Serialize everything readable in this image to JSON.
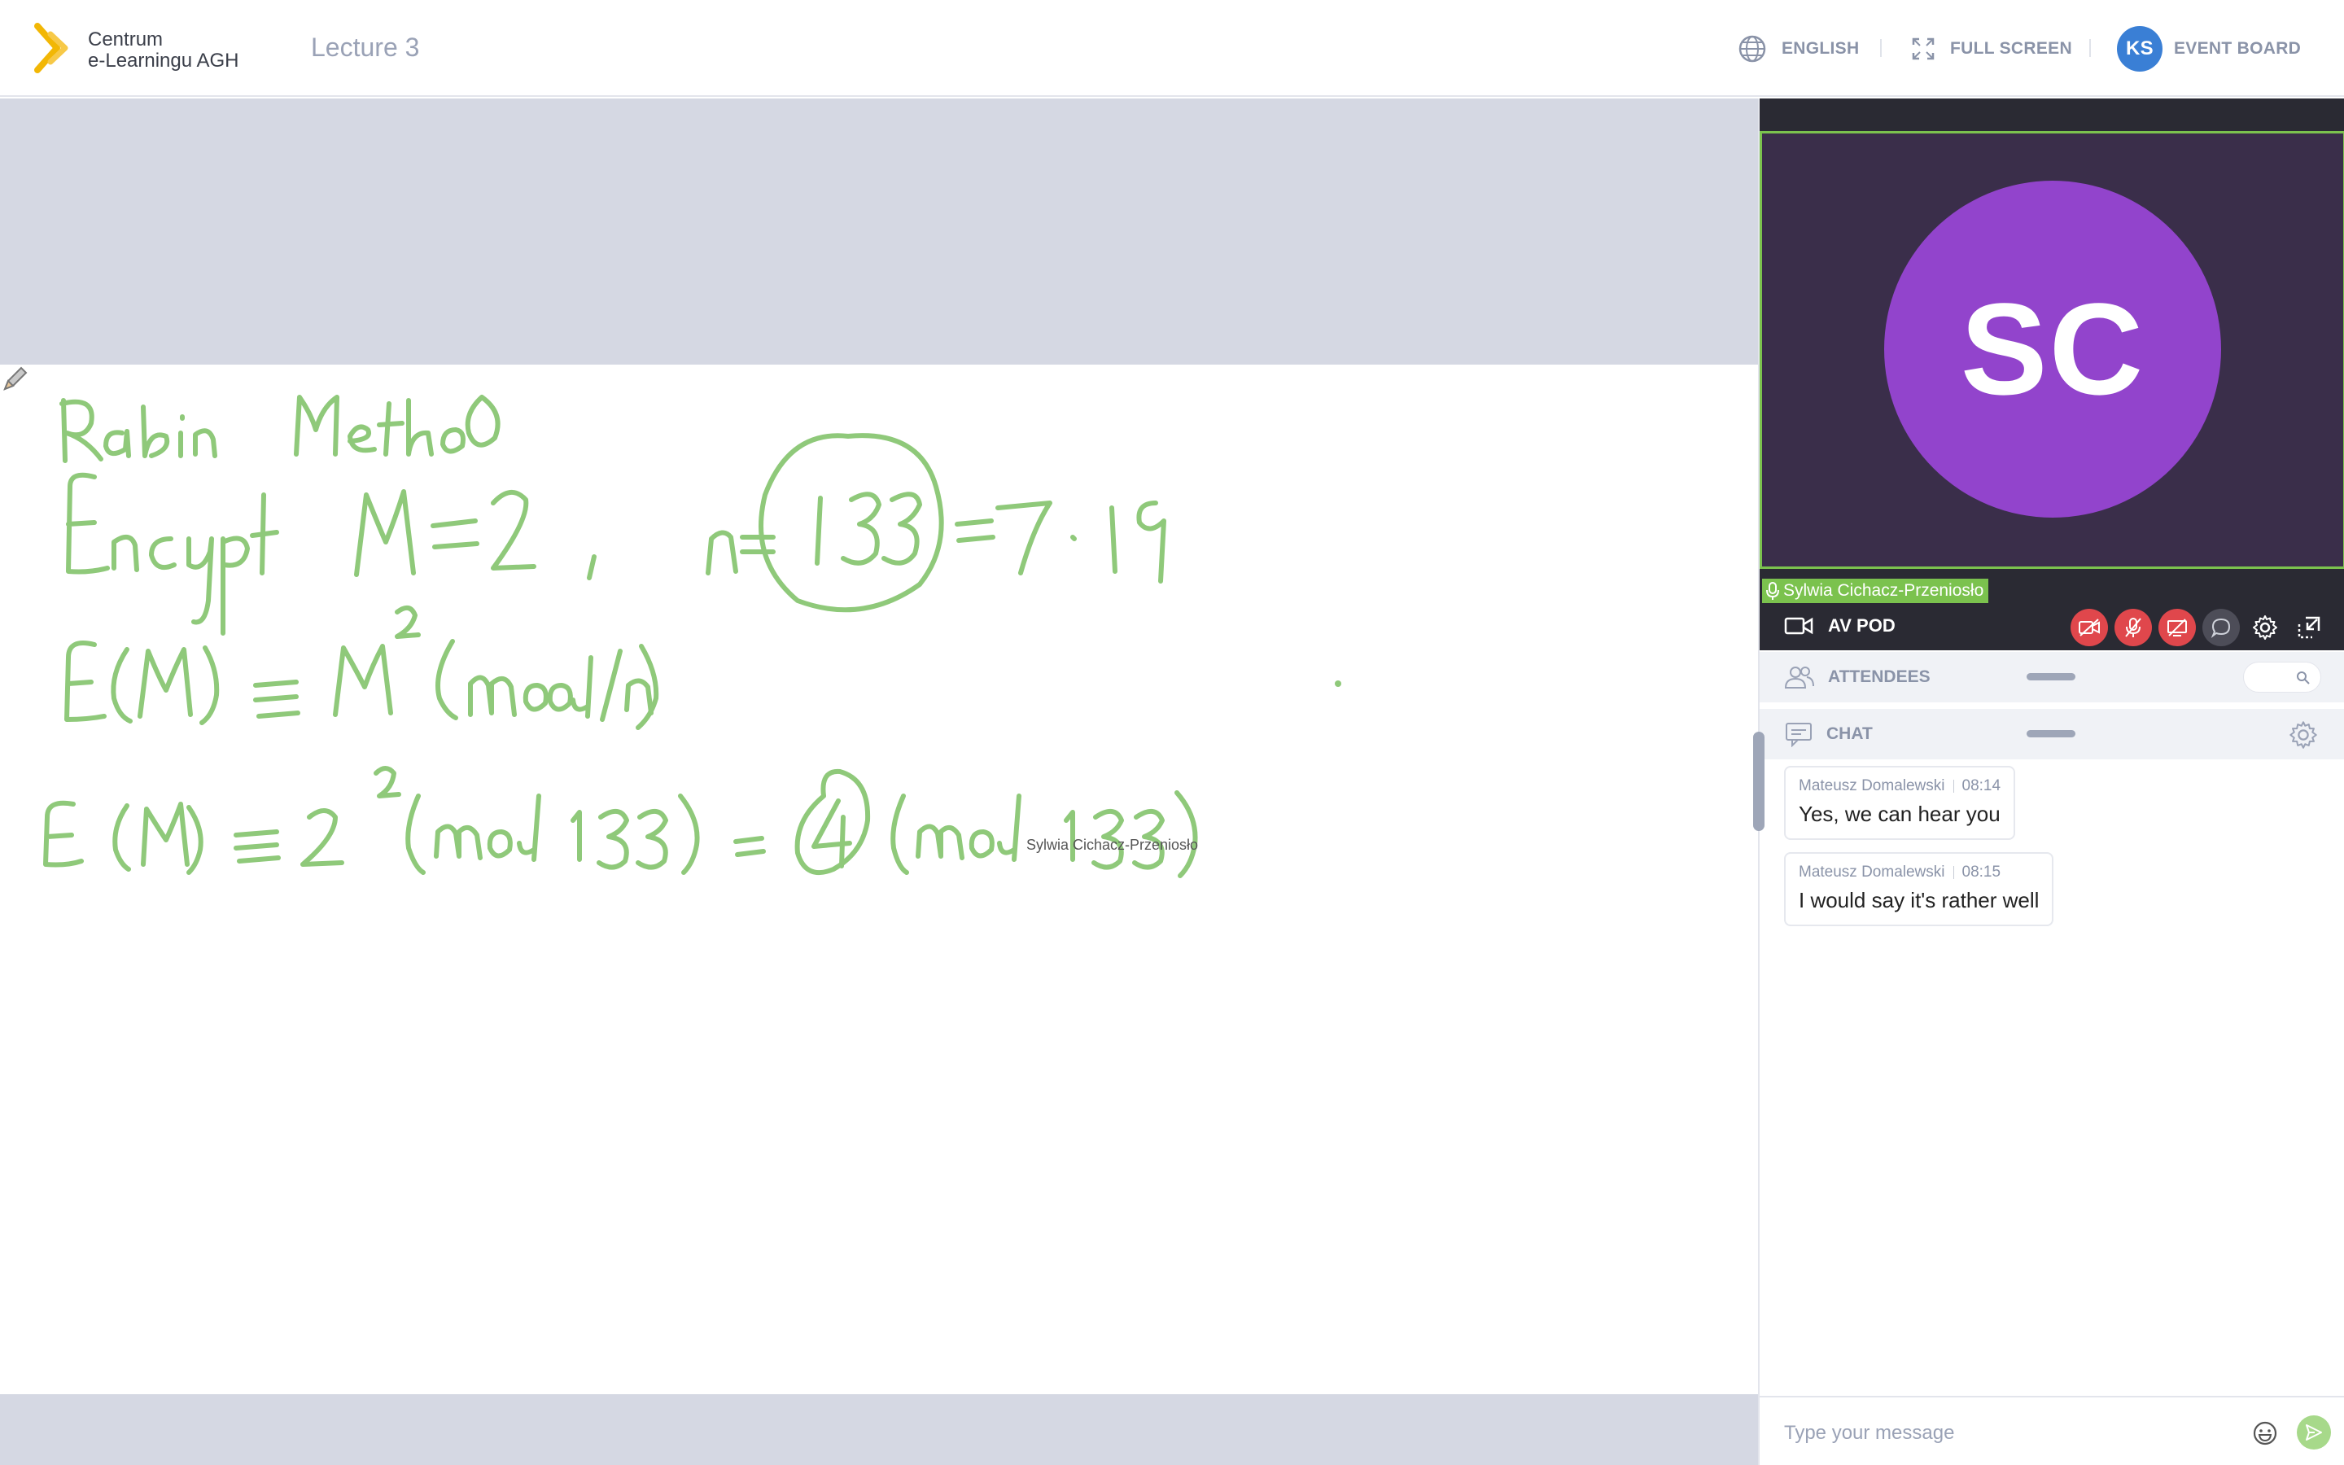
{
  "header": {
    "logo_line1": "Centrum",
    "logo_line2": "e-Learningu AGH",
    "lecture_title": "Lecture 3",
    "language_label": "ENGLISH",
    "fullscreen_label": "FULL SCREEN",
    "user_initials": "KS",
    "event_board_label": "EVENT BOARD"
  },
  "whiteboard": {
    "cursor_user": "Sylwia Cichacz-Przeniosło",
    "ink_color": "#8fc97a"
  },
  "av_pod": {
    "title": "AV POD",
    "speaker_initials": "SC",
    "speaker_name": "Sylwia Cichacz-Przeniosło"
  },
  "attendees": {
    "label": "ATTENDEES"
  },
  "chat": {
    "label": "CHAT",
    "messages": [
      {
        "author": "Mateusz Domalewski",
        "time": "08:14",
        "text": "Yes, we can hear you"
      },
      {
        "author": "Mateusz Domalewski",
        "time": "08:15",
        "text": "I would say it's rather well"
      }
    ],
    "placeholder": "Type your message"
  },
  "colors": {
    "accent_green": "#7bc24e",
    "avatar_purple": "#9244cc",
    "user_blue": "#3a7fd5",
    "danger_red": "#e0474c"
  }
}
